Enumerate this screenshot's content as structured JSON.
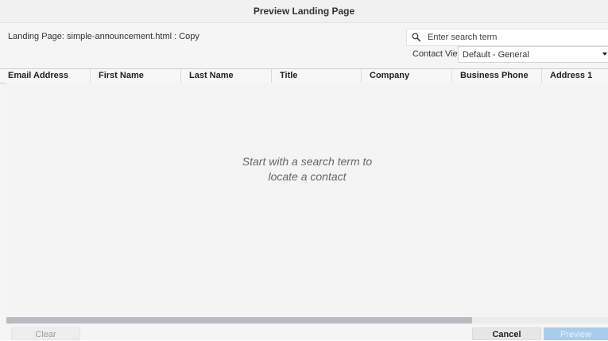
{
  "dialog": {
    "title": "Preview Landing Page"
  },
  "toolbar": {
    "landing_page_label": "Landing Page: simple-announcement.html : Copy",
    "search": {
      "placeholder": "Enter search term",
      "value": ""
    },
    "contact_view": {
      "label": "Contact View",
      "selected": "Default - General"
    }
  },
  "grid": {
    "columns": [
      "Email Address",
      "First Name",
      "Last Name",
      "Title",
      "Company",
      "Business Phone",
      "Address 1"
    ],
    "rows": [],
    "empty_message": [
      "Start with a search term to",
      "locate a contact"
    ],
    "horizontal_scroll_fraction": 0.77
  },
  "footer": {
    "clear_label": "Clear",
    "cancel_label": "Cancel",
    "preview_label": "Preview"
  },
  "colors": {
    "primary_disabled": "#a9ccec",
    "scrollbar_thumb": "#b8bbc1"
  }
}
